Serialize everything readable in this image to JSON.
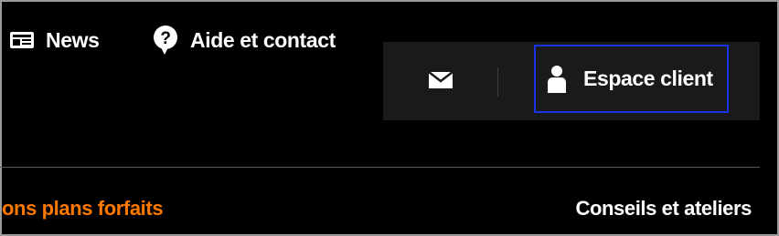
{
  "nav": {
    "news_label": "News",
    "aide_label": "Aide et contact",
    "espace_label": "Espace client"
  },
  "icons": {
    "news": "newspaper-icon",
    "aide": "help-bubble-icon",
    "mail": "envelope-icon",
    "user": "user-icon"
  },
  "subnav": {
    "left_label": "ons plans forfaits",
    "right_label": "Conseils et ateliers"
  },
  "colors": {
    "accent_orange": "#ff7900",
    "focus_blue": "#1a33e6",
    "panel": "#1a1a1a"
  }
}
